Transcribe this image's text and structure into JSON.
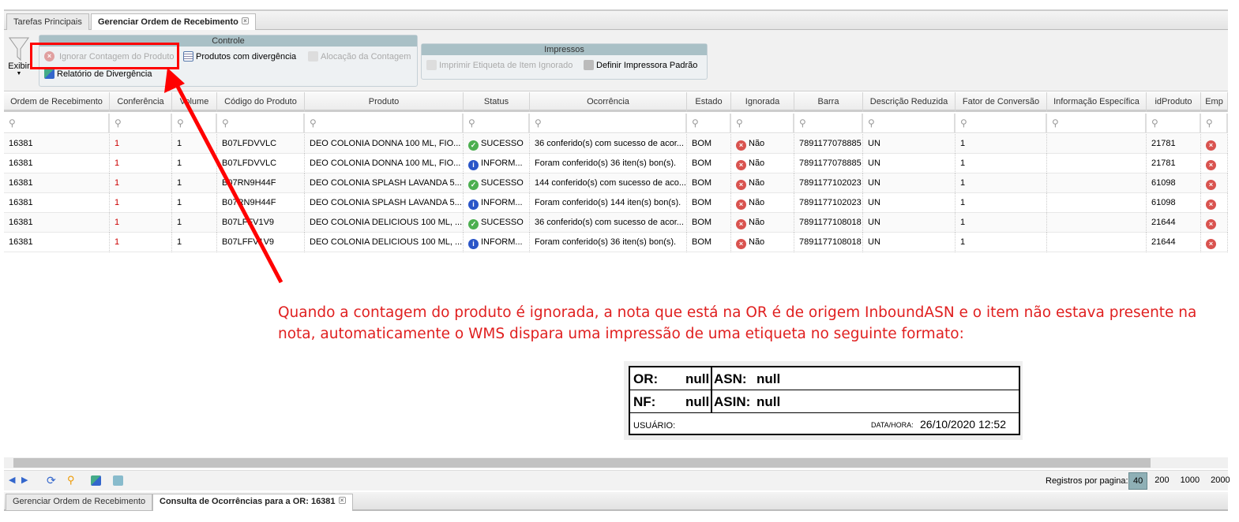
{
  "tabs": [
    {
      "label": "Tarefas Principais"
    },
    {
      "label": "Gerenciar Ordem de Recebimento"
    }
  ],
  "toolbar": {
    "exibir": "Exibir",
    "controle": {
      "title": "Controle",
      "ignorar": "Ignorar Contagem do Produto",
      "produtos_div": "Produtos com divergência",
      "alocacao": "Alocação da Contagem",
      "relatorio": "Relatório de Divergência"
    },
    "impressos": {
      "title": "Impressos",
      "imprimir": "Imprimir Etiqueta de Item Ignorado",
      "definir": "Definir Impressora Padrão"
    }
  },
  "grid": {
    "columns": [
      "Ordem de Recebimento",
      "Conferência",
      "Volume",
      "Código do Produto",
      "Produto",
      "Status",
      "Ocorrência",
      "Estado",
      "Ignorada",
      "Barra",
      "Descrição Reduzida",
      "Fator de Conversão",
      "Informação Específica",
      "idProduto",
      "Emp"
    ],
    "rows": [
      [
        "16381",
        "1",
        "1",
        "B07LFDVVLC",
        "DEO COLONIA DONNA 100 ML, FIO...",
        "SUCESSO",
        "36 conferido(s) com sucesso de acor...",
        "BOM",
        "Não",
        "7891177078885",
        "UN",
        "1",
        "",
        "21781"
      ],
      [
        "16381",
        "1",
        "1",
        "B07LFDVVLC",
        "DEO COLONIA DONNA 100 ML, FIO...",
        "INFORM...",
        "Foram conferido(s) 36 iten(s) bon(s).",
        "BOM",
        "Não",
        "7891177078885",
        "UN",
        "1",
        "",
        "21781"
      ],
      [
        "16381",
        "1",
        "1",
        "B07RN9H44F",
        "DEO COLONIA SPLASH LAVANDA 5...",
        "SUCESSO",
        "144 conferido(s) com sucesso de aco...",
        "BOM",
        "Não",
        "7891177102023",
        "UN",
        "1",
        "",
        "61098"
      ],
      [
        "16381",
        "1",
        "1",
        "B07RN9H44F",
        "DEO COLONIA SPLASH LAVANDA 5...",
        "INFORM...",
        "Foram conferido(s) 144 iten(s) bon(s).",
        "BOM",
        "Não",
        "7891177102023",
        "UN",
        "1",
        "",
        "61098"
      ],
      [
        "16381",
        "1",
        "1",
        "B07LFFV1V9",
        "DEO COLONIA DELICIOUS 100 ML, ...",
        "SUCESSO",
        "36 conferido(s) com sucesso de acor...",
        "BOM",
        "Não",
        "7891177108018",
        "UN",
        "1",
        "",
        "21644"
      ],
      [
        "16381",
        "1",
        "1",
        "B07LFFV1V9",
        "DEO COLONIA DELICIOUS 100 ML, ...",
        "INFORM...",
        "Foram conferido(s) 36 iten(s) bon(s).",
        "BOM",
        "Não",
        "7891177108018",
        "UN",
        "1",
        "",
        "21644"
      ]
    ]
  },
  "annotation": {
    "text": "Quando a contagem do produto é ignorada, a nota que está na OR é de origem InboundASN e o item não estava presente na nota, automaticamente o WMS dispara uma impressão de uma etiqueta no seguinte formato:",
    "color": "#e02020"
  },
  "label": {
    "or_label": "OR:",
    "or_value": "null",
    "asn_label": "ASN:",
    "asn_value": "null",
    "nf_label": "NF:",
    "nf_value": "null",
    "asin_label": "ASIN:",
    "asin_value": "null",
    "usuario": "USUÁRIO:",
    "datahora_label": "DATA/HORA:",
    "datahora_value": "26/10/2020 12:52"
  },
  "pager": {
    "label": "Registros por pagina:",
    "options": [
      "40",
      "200",
      "1000",
      "2000"
    ],
    "selected": "40"
  },
  "bottom_tabs": [
    {
      "label": "Gerenciar Ordem de Recebimento"
    },
    {
      "label": "Consulta de Ocorrências para a OR: 16381"
    }
  ]
}
